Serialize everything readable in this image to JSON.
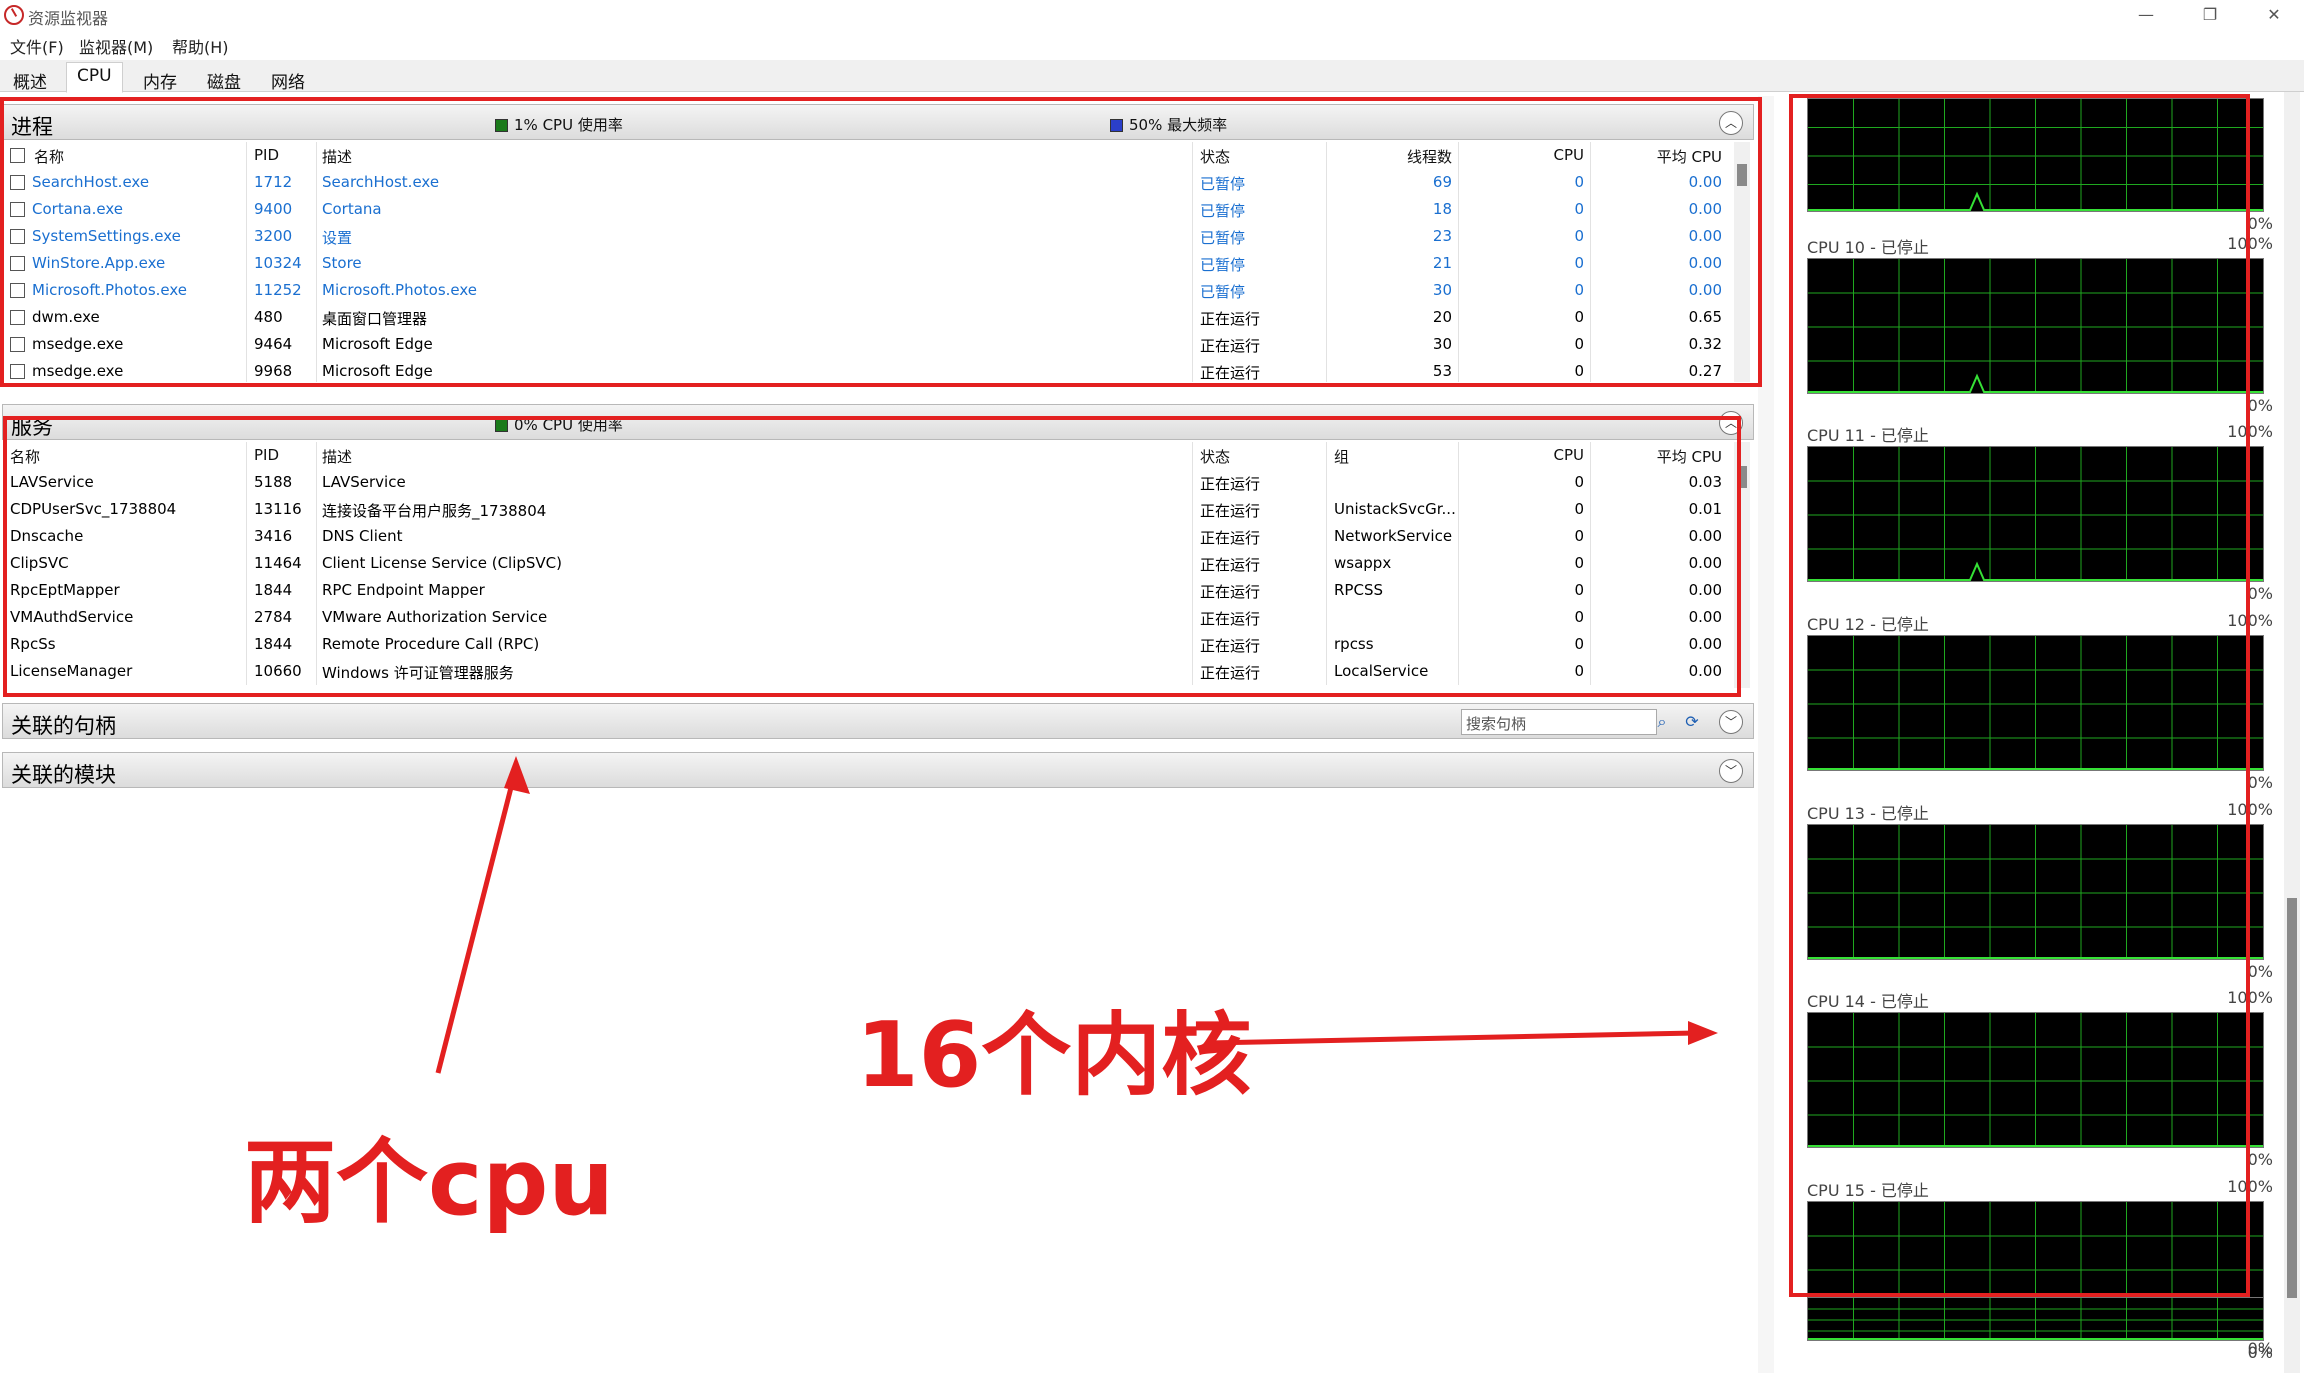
{
  "window": {
    "title": "资源监视器",
    "minimize": "—",
    "restore": "❐",
    "close": "✕"
  },
  "menu": [
    "文件(F)",
    "监视器(M)",
    "帮助(H)"
  ],
  "tabs": [
    "概述",
    "CPU",
    "内存",
    "磁盘",
    "网络"
  ],
  "active_tab": "CPU",
  "colors": {
    "accent_red": "#e32020",
    "link_blue": "#1a6fd0",
    "graph_grid": "#1fa81f",
    "graph_line": "#36e136"
  },
  "processes": {
    "title": "进程",
    "legend_usage": "1% CPU 使用率",
    "legend_freq": "50% 最大频率",
    "usage_color": "#1a7a1a",
    "freq_color": "#2b3fc9",
    "columns": [
      "名称",
      "PID",
      "描述",
      "状态",
      "线程数",
      "CPU",
      "平均 CPU"
    ],
    "rows": [
      {
        "name": "SearchHost.exe",
        "pid": "1712",
        "desc": "SearchHost.exe",
        "status": "已暂停",
        "threads": "69",
        "cpu": "0",
        "avg": "0.00"
      },
      {
        "name": "Cortana.exe",
        "pid": "9400",
        "desc": "Cortana",
        "status": "已暂停",
        "threads": "18",
        "cpu": "0",
        "avg": "0.00"
      },
      {
        "name": "SystemSettings.exe",
        "pid": "3200",
        "desc": "设置",
        "status": "已暂停",
        "threads": "23",
        "cpu": "0",
        "avg": "0.00"
      },
      {
        "name": "WinStore.App.exe",
        "pid": "10324",
        "desc": "Store",
        "status": "已暂停",
        "threads": "21",
        "cpu": "0",
        "avg": "0.00"
      },
      {
        "name": "Microsoft.Photos.exe",
        "pid": "11252",
        "desc": "Microsoft.Photos.exe",
        "status": "已暂停",
        "threads": "30",
        "cpu": "0",
        "avg": "0.00"
      },
      {
        "name": "dwm.exe",
        "pid": "480",
        "desc": "桌面窗口管理器",
        "status": "正在运行",
        "threads": "20",
        "cpu": "0",
        "avg": "0.65"
      },
      {
        "name": "msedge.exe",
        "pid": "9464",
        "desc": "Microsoft Edge",
        "status": "正在运行",
        "threads": "30",
        "cpu": "0",
        "avg": "0.32"
      },
      {
        "name": "msedge.exe",
        "pid": "9968",
        "desc": "Microsoft Edge",
        "status": "正在运行",
        "threads": "53",
        "cpu": "0",
        "avg": "0.27"
      }
    ]
  },
  "services": {
    "title": "服务",
    "legend_usage": "0% CPU 使用率",
    "columns": [
      "名称",
      "PID",
      "描述",
      "状态",
      "组",
      "CPU",
      "平均 CPU"
    ],
    "rows": [
      {
        "name": "LAVService",
        "pid": "5188",
        "desc": "LAVService",
        "status": "正在运行",
        "group": "",
        "cpu": "0",
        "avg": "0.03"
      },
      {
        "name": "CDPUserSvc_1738804",
        "pid": "13116",
        "desc": "连接设备平台用户服务_1738804",
        "status": "正在运行",
        "group": "UnistackSvcGr...",
        "cpu": "0",
        "avg": "0.01"
      },
      {
        "name": "Dnscache",
        "pid": "3416",
        "desc": "DNS Client",
        "status": "正在运行",
        "group": "NetworkService",
        "cpu": "0",
        "avg": "0.00"
      },
      {
        "name": "ClipSVC",
        "pid": "11464",
        "desc": "Client License Service (ClipSVC)",
        "status": "正在运行",
        "group": "wsappx",
        "cpu": "0",
        "avg": "0.00"
      },
      {
        "name": "RpcEptMapper",
        "pid": "1844",
        "desc": "RPC Endpoint Mapper",
        "status": "正在运行",
        "group": "RPCSS",
        "cpu": "0",
        "avg": "0.00"
      },
      {
        "name": "VMAuthdService",
        "pid": "2784",
        "desc": "VMware Authorization Service",
        "status": "正在运行",
        "group": "",
        "cpu": "0",
        "avg": "0.00"
      },
      {
        "name": "RpcSs",
        "pid": "1844",
        "desc": "Remote Procedure Call (RPC)",
        "status": "正在运行",
        "group": "rpcss",
        "cpu": "0",
        "avg": "0.00"
      },
      {
        "name": "LicenseManager",
        "pid": "10660",
        "desc": "Windows 许可证管理器服务",
        "status": "正在运行",
        "group": "LocalService",
        "cpu": "0",
        "avg": "0.00"
      }
    ]
  },
  "handles": {
    "title": "关联的句柄",
    "search_placeholder": "搜索句柄"
  },
  "modules": {
    "title": "关联的模块"
  },
  "cpu_graphs": {
    "graphs": [
      {
        "label": "",
        "top_pct": "",
        "bottom_pct": "0%",
        "spike": true
      },
      {
        "label": "CPU 10 - 已停止",
        "top_pct": "100%",
        "bottom_pct": "0%",
        "spike": true
      },
      {
        "label": "CPU 11 - 已停止",
        "top_pct": "100%",
        "bottom_pct": "0%",
        "spike": true
      },
      {
        "label": "CPU 12 - 已停止",
        "top_pct": "100%",
        "bottom_pct": "0%",
        "spike": false
      },
      {
        "label": "CPU 13 - 已停止",
        "top_pct": "100%",
        "bottom_pct": "0%",
        "spike": false
      },
      {
        "label": "CPU 14 - 已停止",
        "top_pct": "100%",
        "bottom_pct": "0%",
        "spike": false
      },
      {
        "label": "CPU 15 - 已停止",
        "top_pct": "100%",
        "bottom_pct": "0%",
        "spike": false
      },
      {
        "label": "",
        "top_pct": "",
        "bottom_pct": "0%",
        "spike": false
      }
    ]
  },
  "annotations": {
    "cores": "16个内核",
    "cpus": "两个cpu"
  }
}
